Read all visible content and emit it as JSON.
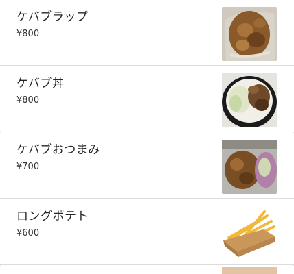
{
  "menu": {
    "items": [
      {
        "name": "ケバブラップ",
        "price": "¥800",
        "image": "kebab-wrap-photo"
      },
      {
        "name": "ケバブ丼",
        "price": "¥800",
        "image": "kebab-rice-bowl-photo"
      },
      {
        "name": "ケバブおつまみ",
        "price": "¥700",
        "image": "kebab-snack-photo"
      },
      {
        "name": "ロングポテト",
        "price": "¥600",
        "image": "long-fries-photo"
      }
    ]
  }
}
